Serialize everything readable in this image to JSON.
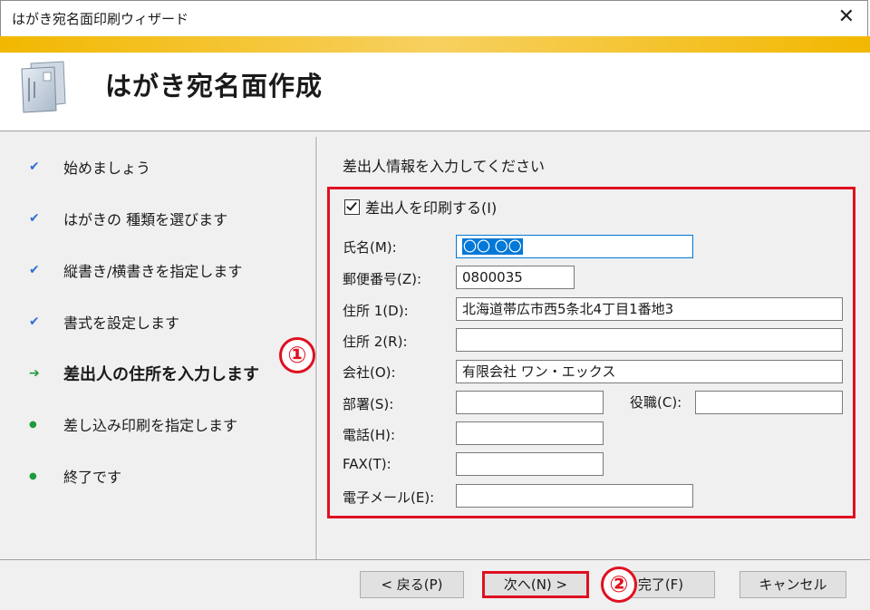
{
  "window": {
    "title": "はがき宛名面印刷ウィザード",
    "close_glyph": "✕"
  },
  "header": {
    "heading": "はがき宛名面作成",
    "icon": "postcard-icon",
    "accent_color": "#f2b800"
  },
  "steps": [
    {
      "label": "始めましょう",
      "state": "done",
      "mark": "✔"
    },
    {
      "label": "はがきの 種類を選びます",
      "state": "done",
      "mark": "✔"
    },
    {
      "label": "縦書き/横書きを指定します",
      "state": "done",
      "mark": "✔"
    },
    {
      "label": "書式を設定します",
      "state": "done",
      "mark": "✔"
    },
    {
      "label": "差出人の住所を入力します",
      "state": "current",
      "mark": "➔"
    },
    {
      "label": "差し込み印刷を指定します",
      "state": "pending",
      "mark": "●"
    },
    {
      "label": "終了です",
      "state": "pending",
      "mark": "●"
    }
  ],
  "form": {
    "prompt": "差出人情報を入力してください",
    "print_sender_label": "差出人を印刷する(I)",
    "print_sender_checked": true,
    "name_label": "氏名(M):",
    "name_value": "〇〇 〇〇",
    "postal_label": "郵便番号(Z):",
    "postal_value": "0800035",
    "address1_label": "住所 1(D):",
    "address1_value": "北海道帯広市西5条北4丁目1番地3",
    "address2_label": "住所 2(R):",
    "address2_value": "",
    "company_label": "会社(O):",
    "company_value": "有限会社 ワン・エックス",
    "dept_label": "部署(S):",
    "dept_value": "",
    "title_label": "役職(C):",
    "title_value": "",
    "phone_label": "電話(H):",
    "phone_value": "",
    "fax_label": "FAX(T):",
    "fax_value": "",
    "email_label": "電子メール(E):",
    "email_value": ""
  },
  "annotations": {
    "marker_1": "①",
    "marker_2": "②",
    "highlight_color": "#e01020"
  },
  "buttons": {
    "back": "< 戻る(P)",
    "next": "次へ(N) >",
    "finish": "完了(F)",
    "cancel": "キャンセル"
  }
}
